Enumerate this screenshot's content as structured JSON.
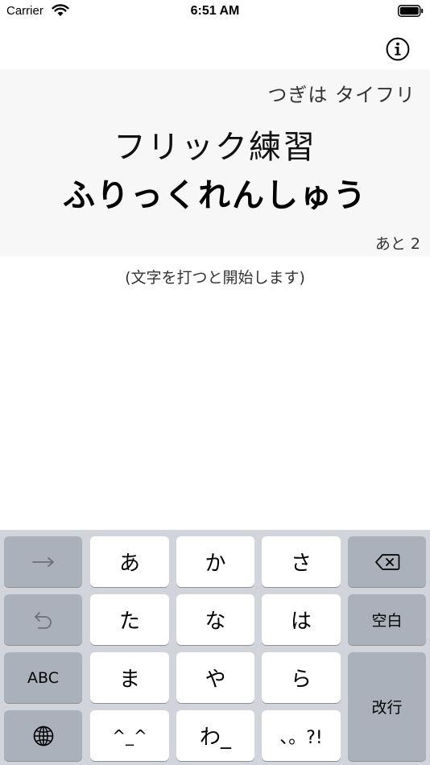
{
  "status_bar": {
    "carrier": "Carrier",
    "time": "6:51 AM"
  },
  "icons": {
    "wifi": "wifi-icon",
    "battery": "battery-icon",
    "info": "info-icon",
    "arrow": "arrow-right-icon",
    "undo": "undo-icon",
    "globe": "globe-icon",
    "delete": "delete-backward-icon"
  },
  "prompt": {
    "next": "つぎは タイフリ",
    "kanji": "フリック練習",
    "reading": "ふりっくれんしゅう",
    "remaining": "あと 2"
  },
  "start_hint": "(文字を打つと開始します)",
  "keyboard": {
    "row1": [
      "あ",
      "か",
      "さ"
    ],
    "row2": [
      "た",
      "な",
      "は"
    ],
    "row3": [
      "ま",
      "や",
      "ら"
    ],
    "row4": [
      "^_^",
      "わ_",
      "、。?!"
    ],
    "space": "空白",
    "abc": "ABC",
    "enter": "改行"
  },
  "colors": {
    "card_background": "#f7f7f7",
    "keyboard_background": "#d1d4db",
    "key_gray": "#abb1bb",
    "key_white": "#ffffff"
  }
}
